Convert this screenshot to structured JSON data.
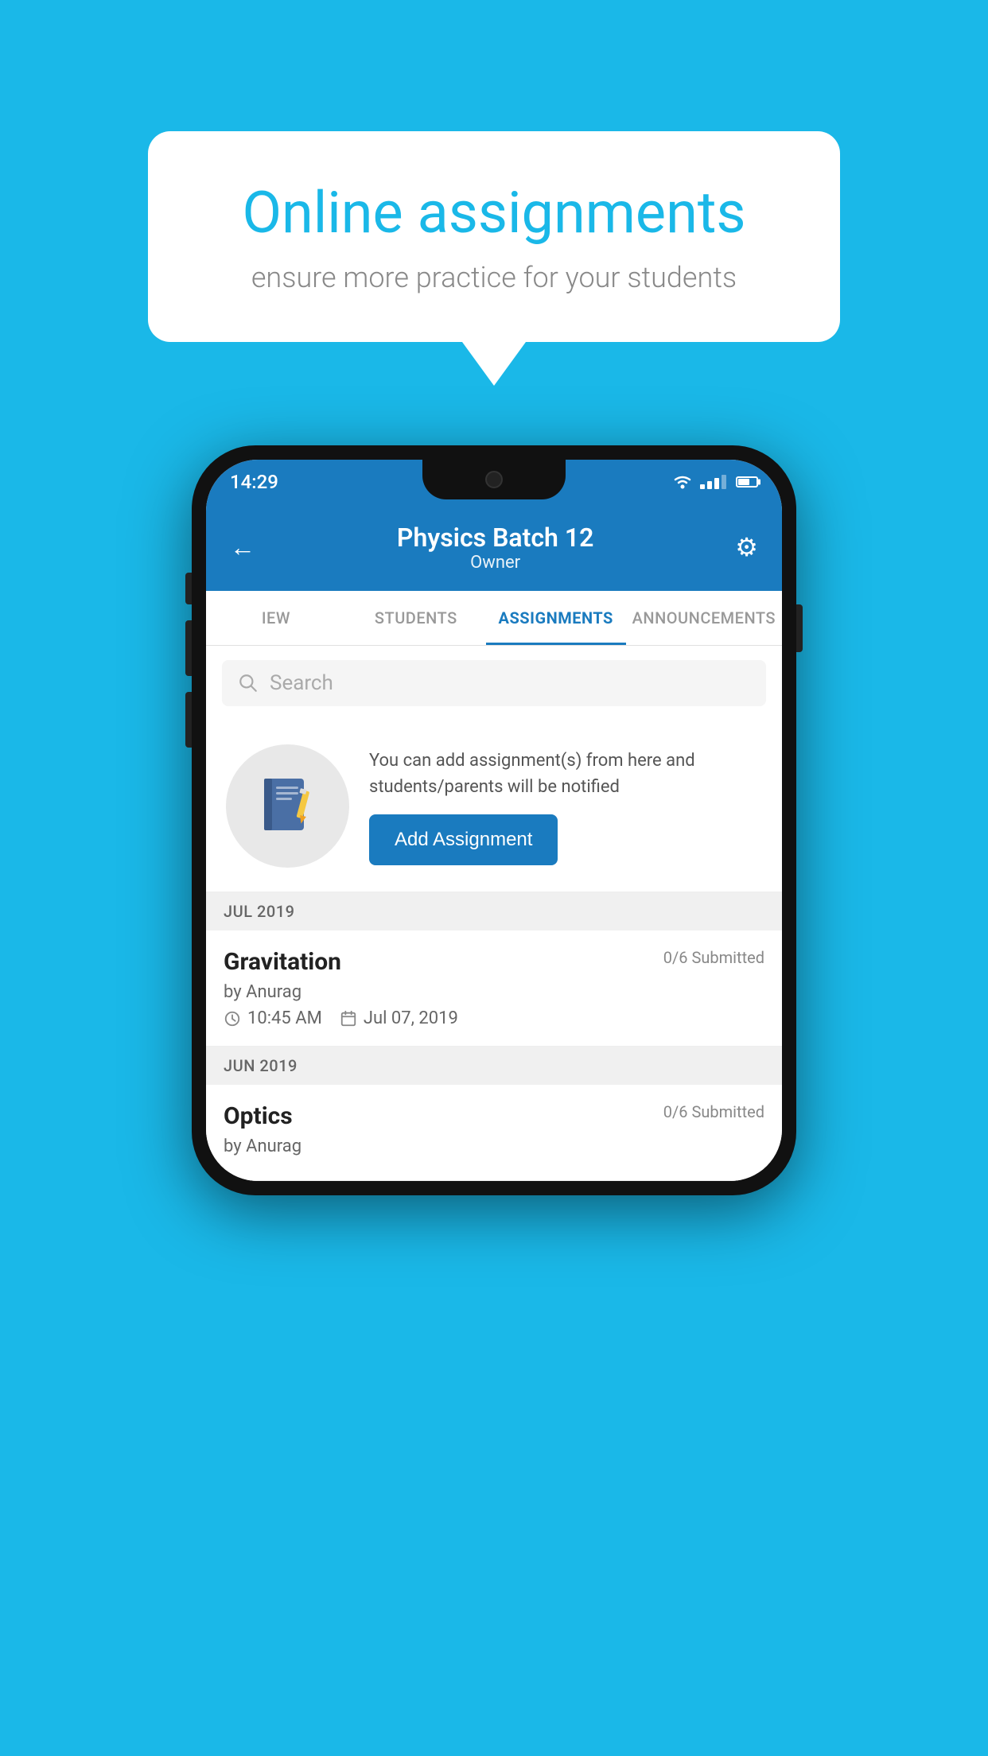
{
  "background_color": "#1ab8e8",
  "speech_bubble": {
    "title": "Online assignments",
    "subtitle": "ensure more practice for your students"
  },
  "status_bar": {
    "time": "14:29"
  },
  "app_header": {
    "title": "Physics Batch 12",
    "subtitle": "Owner",
    "back_label": "←",
    "settings_label": "⚙"
  },
  "tabs": [
    {
      "label": "IEW",
      "active": false
    },
    {
      "label": "STUDENTS",
      "active": false
    },
    {
      "label": "ASSIGNMENTS",
      "active": true
    },
    {
      "label": "ANNOUNCEMENTS",
      "active": false
    }
  ],
  "search": {
    "placeholder": "Search"
  },
  "promo": {
    "text": "You can add assignment(s) from here and students/parents will be notified",
    "button_label": "Add Assignment"
  },
  "assignments": [
    {
      "month_header": "JUL 2019",
      "items": [
        {
          "name": "Gravitation",
          "submitted": "0/6 Submitted",
          "author": "by Anurag",
          "time": "10:45 AM",
          "date": "Jul 07, 2019"
        }
      ]
    },
    {
      "month_header": "JUN 2019",
      "items": [
        {
          "name": "Optics",
          "submitted": "0/6 Submitted",
          "author": "by Anurag",
          "time": "",
          "date": ""
        }
      ]
    }
  ]
}
